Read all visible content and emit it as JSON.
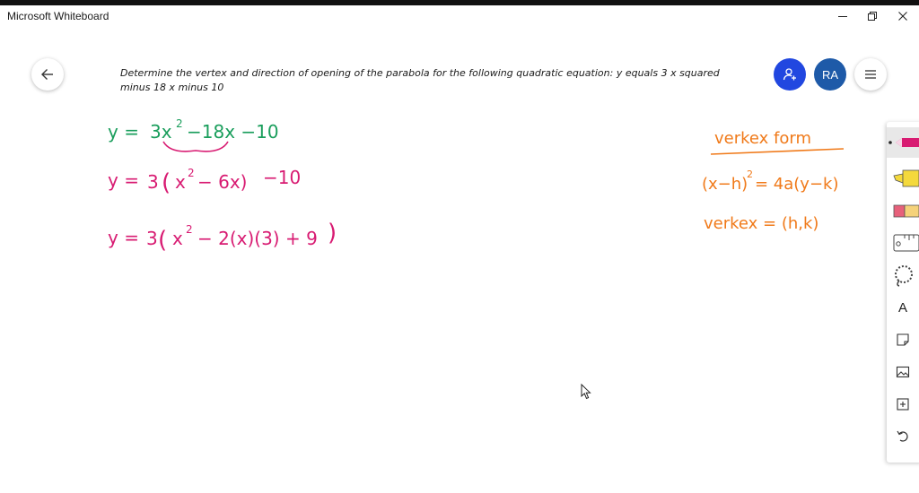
{
  "window": {
    "title": "Microsoft Whiteboard",
    "controls": [
      "minimize",
      "restore",
      "close"
    ]
  },
  "header": {
    "back_icon": "arrow-left-icon",
    "share_icon": "person-add-icon",
    "avatar_initials": "RA",
    "menu_icon": "hamburger-menu-icon"
  },
  "question_text": "Determine the vertex and direction of opening of the parabola for the following quadratic equation: y equals 3 x squared minus 18 x minus 10",
  "ink": {
    "green_line": {
      "color": "#1a9e5c",
      "lhs": "y =",
      "coef": "3x",
      "exp": "2",
      "rest": "−18x −10"
    },
    "pink_line_1": {
      "color": "#d81b72",
      "lhs": "y =",
      "coef": "3",
      "open": "(",
      "base": "x",
      "exp": "2",
      "rest": "− 6x)",
      "tail": "−10"
    },
    "pink_line_2": {
      "color": "#d81b72",
      "lhs": "y =",
      "coef": "3",
      "open": "(",
      "base": "x",
      "exp": "2",
      "rest": "− 2(x)(3) + 9",
      "close": ")"
    },
    "orange_title": {
      "color": "#f07a1a",
      "text": "verkex form"
    },
    "orange_formula": {
      "base": "(x−h)",
      "exp": "2",
      "rest": "= 4a(y−k)"
    },
    "orange_vertex": {
      "text": "verkex = (h,k)"
    }
  },
  "toolbar": {
    "tools": [
      "pen-icon",
      "highlighter-icon",
      "eraser-icon",
      "ruler-icon",
      "lasso-icon",
      "text-icon",
      "sticky-note-icon",
      "image-icon",
      "add-icon",
      "undo-icon"
    ],
    "text_tool_label": "A"
  }
}
